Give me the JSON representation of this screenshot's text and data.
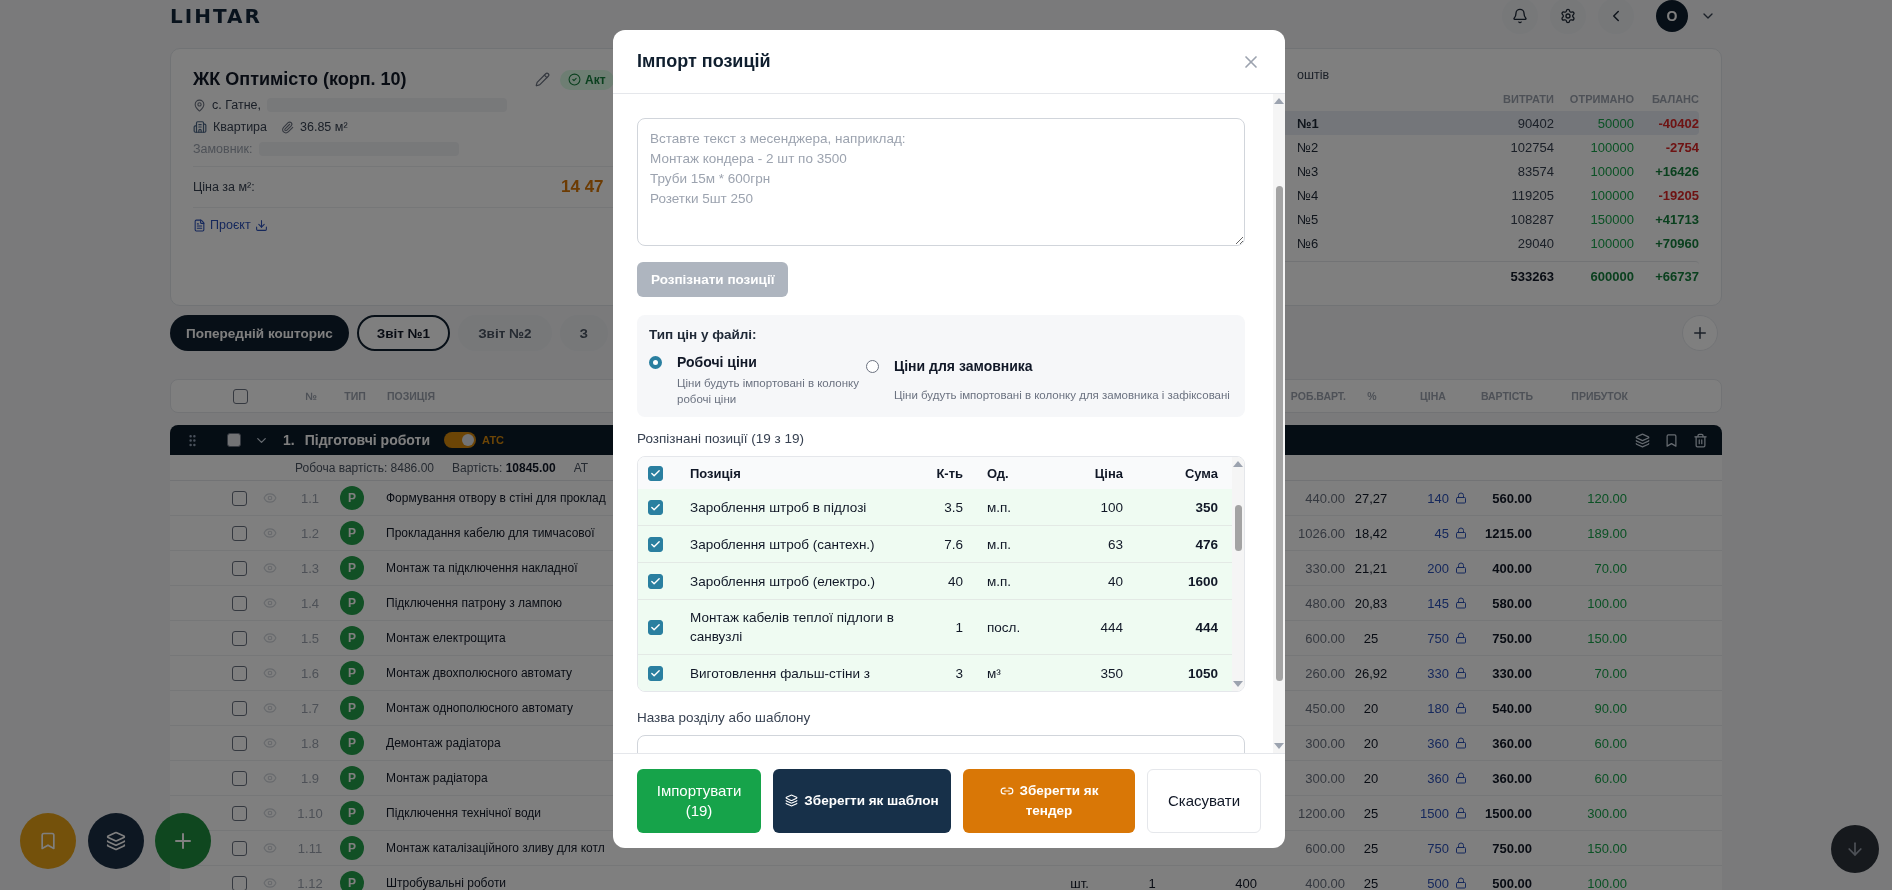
{
  "header": {
    "logo": "LIHTAR",
    "avatar": "О"
  },
  "project": {
    "title": "ЖК Оптимісто (корп. 10)",
    "status": "Акт",
    "address": "с. Гатне,",
    "property_type": "Квартира",
    "area": "36.85 м²",
    "customer_label": "Замовник:",
    "price_label": "Ціна за м²:",
    "price_value": "14 47",
    "project_link": "Проєкт"
  },
  "funds": {
    "title": "оштів",
    "columns": [
      "ВИТРАТИ",
      "ОТРИМАНО",
      "БАЛАНС"
    ],
    "rows": [
      {
        "label": "№1",
        "expenses": "90402",
        "received": "50000",
        "balance": "-40402",
        "negative": true,
        "selected": true
      },
      {
        "label": "№2",
        "expenses": "102754",
        "received": "100000",
        "balance": "-2754",
        "negative": true,
        "selected": false
      },
      {
        "label": "№3",
        "expenses": "83574",
        "received": "100000",
        "balance": "+16426",
        "negative": false,
        "selected": false
      },
      {
        "label": "№4",
        "expenses": "119205",
        "received": "100000",
        "balance": "-19205",
        "negative": true,
        "selected": false
      },
      {
        "label": "№5",
        "expenses": "108287",
        "received": "150000",
        "balance": "+41713",
        "negative": false,
        "selected": false
      },
      {
        "label": "№6",
        "expenses": "29040",
        "received": "100000",
        "balance": "+70960",
        "negative": false,
        "selected": false
      }
    ],
    "total": {
      "expenses": "533263",
      "received": "600000",
      "balance": "+66737"
    }
  },
  "tabs": [
    {
      "kind": "estimate",
      "label": "Попередній кошторис",
      "selected": false
    },
    {
      "kind": "report",
      "label": "Звіт №1",
      "selected": true
    },
    {
      "kind": "report",
      "label": "Звіт №2",
      "selected": false
    },
    {
      "kind": "report",
      "label": "З",
      "selected": false
    }
  ],
  "table": {
    "columns_left": [
      "№",
      "ТИП",
      "ПОЗИЦІЯ"
    ],
    "columns_right": [
      "РОБ.ВАРТ.",
      "%",
      "ЦІНА",
      "ВАРТІСТЬ",
      "ПРИБУТОК"
    ],
    "section": {
      "number": "1.",
      "title": "Підготовчі роботи",
      "checked": false,
      "ats_on": true,
      "ats_label": "АТС",
      "expanded": true
    },
    "summary": [
      "Робоча вартість: 8486.00",
      "Вартість: **10845.00**",
      "АТ"
    ],
    "rows": [
      {
        "number": "1.1",
        "type": "P",
        "name": "Формування отвору в стіні для проклад",
        "work_cost": "440.00",
        "percent": "27,27",
        "price": "140",
        "cost": "560.00",
        "profit": "120.00",
        "checked": false
      },
      {
        "number": "1.2",
        "type": "P",
        "name": "Прокладання кабелю для тимчасової",
        "work_cost": "1026.00",
        "percent": "18,42",
        "price": "45",
        "cost": "1215.00",
        "profit": "189.00",
        "checked": false
      },
      {
        "number": "1.3",
        "type": "P",
        "name": "Монтаж та підключення накладної",
        "work_cost": "330.00",
        "percent": "21,21",
        "price": "200",
        "cost": "400.00",
        "profit": "70.00",
        "checked": false
      },
      {
        "number": "1.4",
        "type": "P",
        "name": "Підключення патрону з лампою",
        "work_cost": "480.00",
        "percent": "20,83",
        "price": "145",
        "cost": "580.00",
        "profit": "100.00",
        "checked": false
      },
      {
        "number": "1.5",
        "type": "P",
        "name": "Монтаж електрощита",
        "work_cost": "600.00",
        "percent": "25",
        "price": "750",
        "cost": "750.00",
        "profit": "150.00",
        "checked": false
      },
      {
        "number": "1.6",
        "type": "P",
        "name": "Монтаж двохполюсного автомату",
        "work_cost": "260.00",
        "percent": "26,92",
        "price": "330",
        "cost": "330.00",
        "profit": "70.00",
        "checked": false
      },
      {
        "number": "1.7",
        "type": "P",
        "name": "Монтаж однополюсного автомату",
        "work_cost": "450.00",
        "percent": "20",
        "price": "180",
        "cost": "540.00",
        "profit": "90.00",
        "checked": false
      },
      {
        "number": "1.8",
        "type": "P",
        "name": "Демонтаж радіатора",
        "work_cost": "300.00",
        "percent": "20",
        "price": "360",
        "cost": "360.00",
        "profit": "60.00",
        "checked": false
      },
      {
        "number": "1.9",
        "type": "P",
        "name": "Монтаж радіатора",
        "work_cost": "300.00",
        "percent": "20",
        "price": "360",
        "cost": "360.00",
        "profit": "60.00",
        "checked": false
      },
      {
        "number": "1.10",
        "type": "P",
        "name": "Підключення технічної води",
        "work_cost": "1200.00",
        "percent": "25",
        "price": "1500",
        "cost": "1500.00",
        "profit": "300.00",
        "checked": false
      },
      {
        "number": "1.11",
        "type": "P",
        "name": "Монтаж каталізаційного зливу для котл",
        "work_cost": "600.00",
        "percent": "25",
        "price": "750",
        "cost": "750.00",
        "profit": "150.00",
        "checked": false
      },
      {
        "number": "1.12",
        "type": "P",
        "name": "Штробувальні роботи",
        "unit": "шт.",
        "qty": "1",
        "work_price": "400",
        "work_cost": "400.00",
        "percent": "25",
        "price": "500",
        "cost": "500.00",
        "profit": "100.00",
        "checked": false
      }
    ]
  },
  "modal": {
    "title": "Імпорт позицій",
    "textarea_placeholder": "Вставте текст з месенджера, наприклад:\nМонтаж кондера - 2 шт по 3500\nТруби 15м * 600грн\nРозетки 5шт 250",
    "recognize_button": {
      "label": "Розпізнати позиції",
      "disabled": true
    },
    "price_type": {
      "title": "Тип цін у файлі:",
      "options": [
        {
          "label": "Робочі ціни",
          "description": "Ціни будуть імпортовані в колонку робочі ціни",
          "selected": true
        },
        {
          "label": "Ціни для замовника",
          "description": "Ціни будуть імпортовані в колонку для замовника і зафіксовані",
          "selected": false
        }
      ]
    },
    "recognized_title": "Розпізнані позиції (19 з 19)",
    "items": {
      "all_checked": true,
      "columns": [
        "Позиція",
        "К-ть",
        "Од.",
        "Ціна",
        "Сума"
      ],
      "rows": [
        {
          "name": "Зароблення штроб в підлозі",
          "qty": "3.5",
          "unit": "м.п.",
          "price": "100",
          "sum": "350",
          "checked": true
        },
        {
          "name": "Зароблення штроб (сантехн.)",
          "qty": "7.6",
          "unit": "м.п.",
          "price": "63",
          "sum": "476",
          "checked": true
        },
        {
          "name": "Зароблення штроб (електро.)",
          "qty": "40",
          "unit": "м.п.",
          "price": "40",
          "sum": "1600",
          "checked": true
        },
        {
          "name": "Монтаж кабелів теплої підлоги в санвузлі",
          "qty": "1",
          "unit": "посл.",
          "price": "444",
          "sum": "444",
          "checked": true
        },
        {
          "name": "Виготовлення фальш-стіни з",
          "qty": "3",
          "unit": "м³",
          "price": "350",
          "sum": "1050",
          "checked": true
        }
      ]
    },
    "section_name_label": "Назва розділу або шаблону",
    "buttons": [
      {
        "kind": "import",
        "label": "Імпортувати (19)"
      },
      {
        "kind": "template",
        "label": "Зберегти як шаблон"
      },
      {
        "kind": "tender",
        "label": "Зберегти як тендер"
      },
      {
        "kind": "cancel",
        "label": "Скасувати"
      }
    ]
  }
}
